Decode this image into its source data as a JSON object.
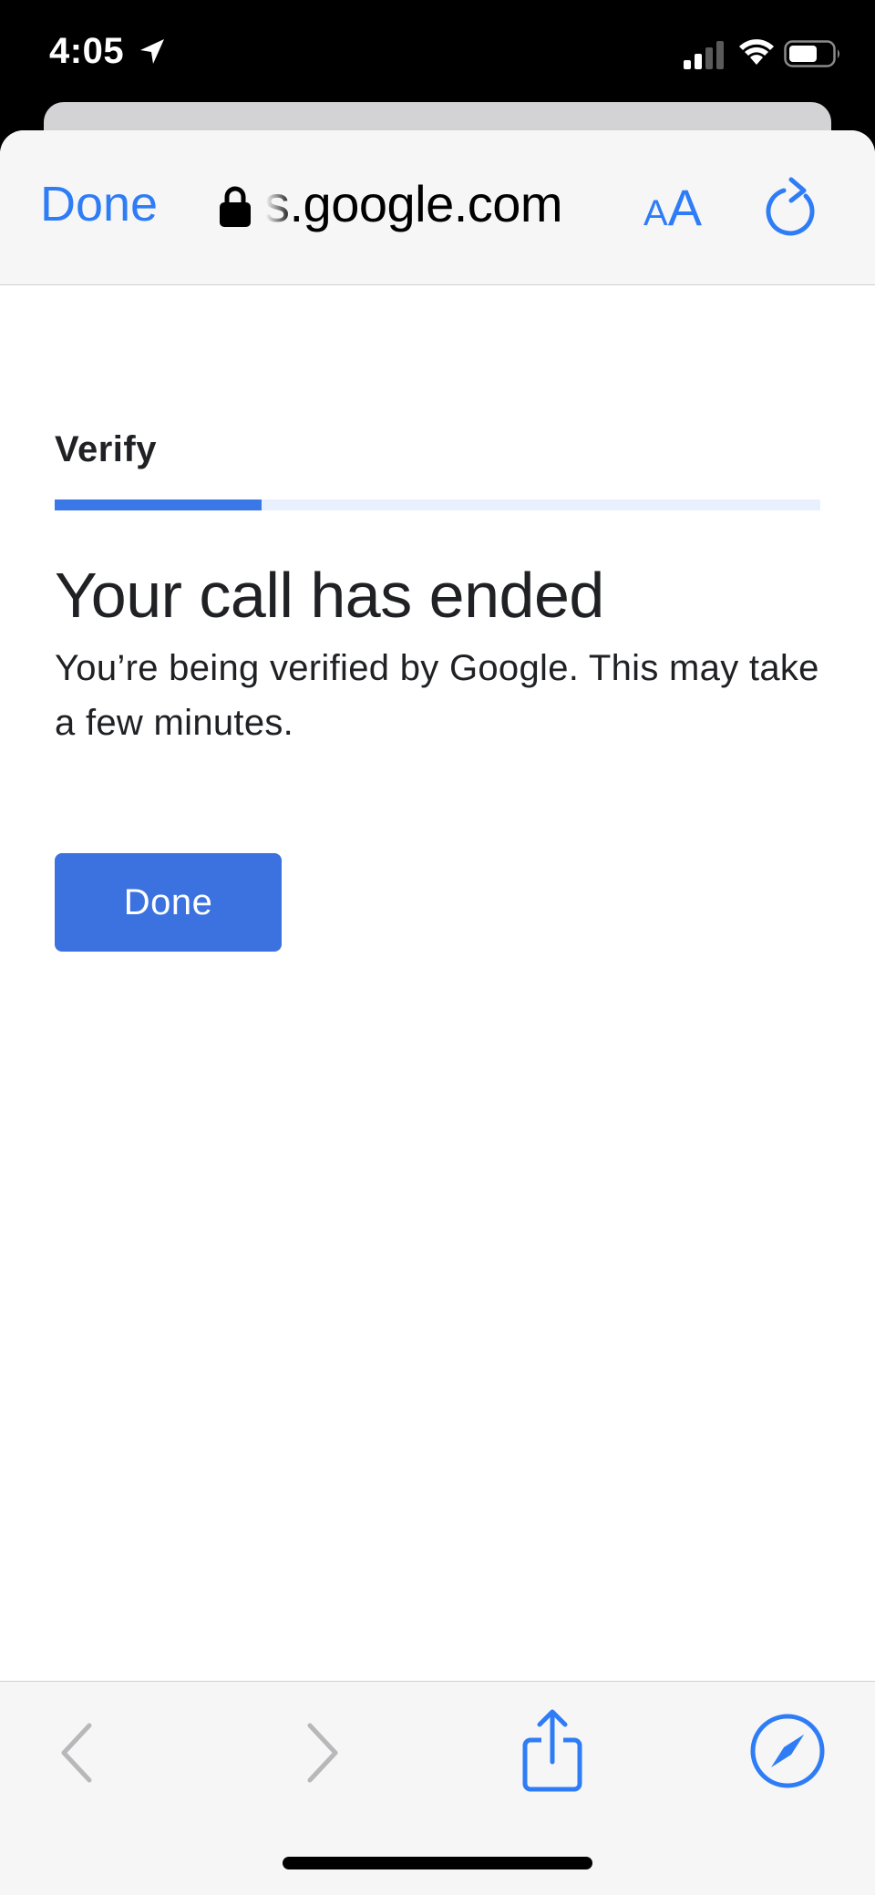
{
  "status_bar": {
    "time": "4:05"
  },
  "top_bar": {
    "done_label": "Done",
    "url": "s.google.com",
    "aa_small": "A",
    "aa_large": "A"
  },
  "page": {
    "step_label": "Verify",
    "progress_percent": 27,
    "title": "Your call has ended",
    "body": "You’re being verified by Google. This may take a few minutes.",
    "done_button_label": "Done"
  },
  "colors": {
    "accent": "#2f7df6",
    "button": "#3b72e0",
    "progress_fill": "#3b78e7",
    "progress_track": "#e8f0fe"
  },
  "icons": {
    "status": [
      "location-arrow-icon",
      "cellular-signal-icon",
      "wifi-icon",
      "battery-icon"
    ],
    "top_bar": [
      "lock-icon",
      "reload-icon"
    ],
    "bottom_bar": [
      "back-chevron-icon",
      "forward-chevron-icon",
      "share-icon",
      "compass-icon"
    ]
  }
}
